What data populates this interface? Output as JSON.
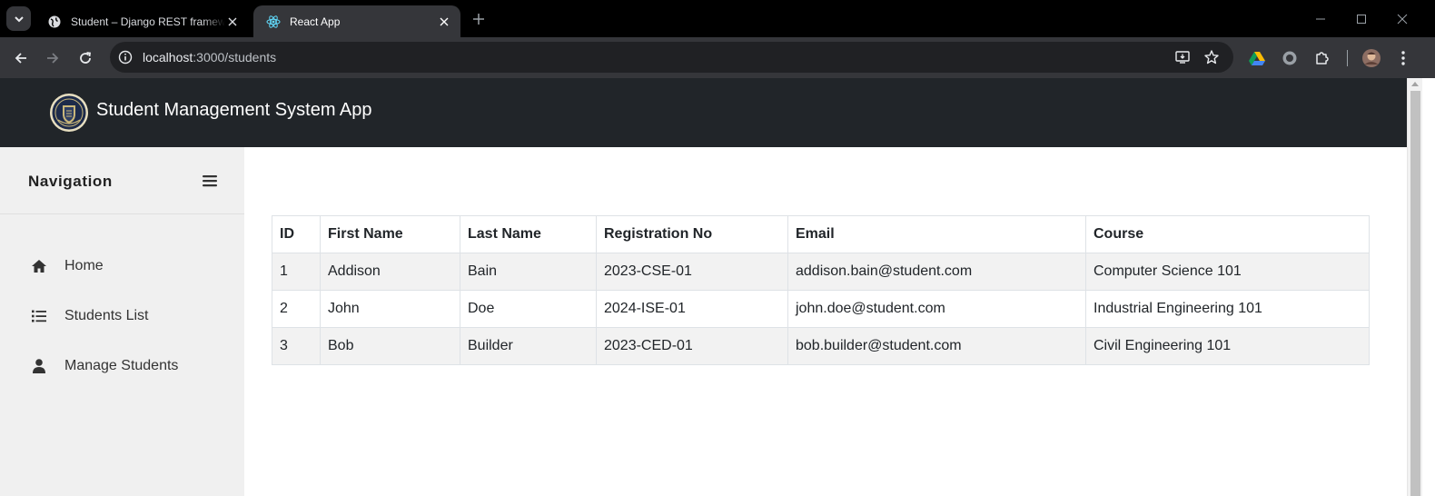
{
  "browser": {
    "tabs": [
      {
        "title": "Student – Django REST framework",
        "active": false,
        "favicon": "globe-icon"
      },
      {
        "title": "React App",
        "active": true,
        "favicon": "react-icon"
      }
    ],
    "url": {
      "host": "localhost",
      "path": ":3000/students"
    }
  },
  "app": {
    "title": "Student Management System App"
  },
  "sidebar": {
    "heading": "Navigation",
    "items": [
      {
        "label": "Home",
        "icon": "home-icon"
      },
      {
        "label": "Students List",
        "icon": "list-icon"
      },
      {
        "label": "Manage Students",
        "icon": "user-icon"
      }
    ]
  },
  "table": {
    "headers": [
      "ID",
      "First Name",
      "Last Name",
      "Registration No",
      "Email",
      "Course"
    ],
    "rows": [
      [
        "1",
        "Addison",
        "Bain",
        "2023-CSE-01",
        "addison.bain@student.com",
        "Computer Science 101"
      ],
      [
        "2",
        "John",
        "Doe",
        "2024-ISE-01",
        "john.doe@student.com",
        "Industrial Engineering 101"
      ],
      [
        "3",
        "Bob",
        "Builder",
        "2023-CED-01",
        "bob.builder@student.com",
        "Civil Engineering 101"
      ]
    ]
  },
  "colors": {
    "header_bg": "#212529",
    "sidebar_bg": "#f0f0f0",
    "stripe_bg": "#f2f2f2",
    "chrome_bg": "#35363a"
  }
}
